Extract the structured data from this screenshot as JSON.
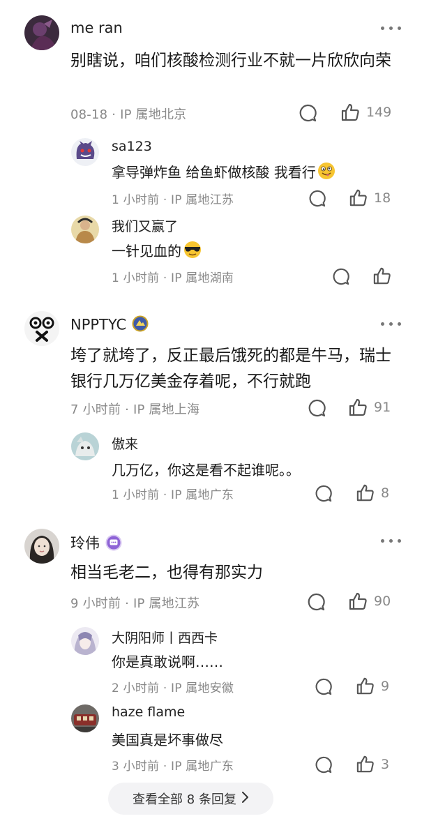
{
  "comments": [
    {
      "user": "me ran",
      "text": "别瞎说，咱们核酸检测行业不就一片欣欣向荣",
      "meta": "08-18 · IP 属地北京",
      "likes": "149",
      "replies": [
        {
          "user": "sa123",
          "text": "拿导弹炸鱼 给鱼虾做核酸 我看行",
          "meta": "1 小时前 · IP 属地江苏",
          "likes": "18"
        },
        {
          "user": "我们又赢了",
          "text": "一针见血的",
          "meta": "1 小时前 · IP 属地湖南",
          "likes": ""
        }
      ]
    },
    {
      "user": "NPPTYC",
      "text": "垮了就垮了，反正最后饿死的都是牛马，瑞士银行几万亿美金存着呢，不行就跑",
      "meta": "7 小时前 · IP 属地上海",
      "likes": "91",
      "replies": [
        {
          "user": "傲来",
          "text": "几万亿，你这是看不起谁呢。。",
          "meta": "1 小时前 · IP 属地广东",
          "likes": "8"
        }
      ]
    },
    {
      "user": "玲伟",
      "text": "相当毛老二，也得有那实力",
      "meta": "9 小时前 · IP 属地江苏",
      "likes": "90",
      "replies": [
        {
          "user": "大阴阳师丨西西卡",
          "text": "你是真敢说啊……",
          "meta": "2 小时前 · IP 属地安徽",
          "likes": "9"
        },
        {
          "user": "haze flame",
          "text": "美国真是坏事做尽",
          "meta": "3 小时前 · IP 属地广东",
          "likes": "3"
        }
      ]
    }
  ],
  "view_all_label": "查看全部 8 条回复",
  "colors": {
    "text": "#1a1a1a",
    "meta": "#888888",
    "pill": "#f3f3f5"
  },
  "icons": [
    "comment-icon",
    "thumbs-up-icon",
    "more-icon",
    "chevron-right-icon"
  ]
}
